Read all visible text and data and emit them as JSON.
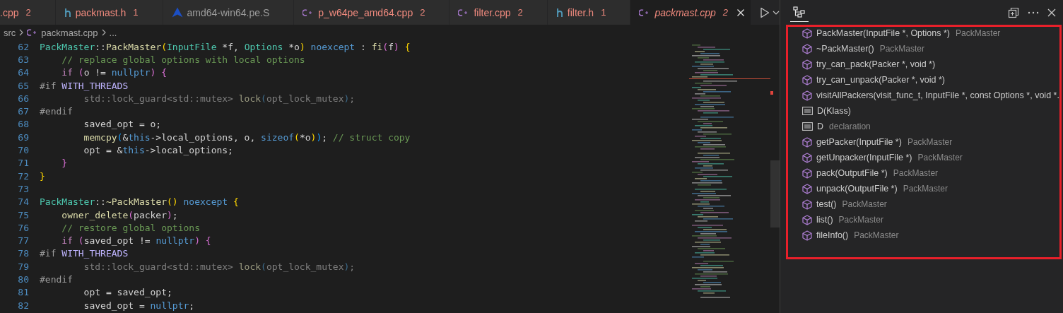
{
  "tabs": [
    {
      "label": ".cpp",
      "problems": "2",
      "selected": false,
      "preview": false
    },
    {
      "kind": "h",
      "label": "packmast.h",
      "problems": "1",
      "selected": false,
      "preview": false
    },
    {
      "kind": "asm",
      "label": "amd64-win64.pe.S",
      "selected": false,
      "preview": false
    },
    {
      "kind": "cpp",
      "label": "p_w64pe_amd64.cpp",
      "problems": "2",
      "selected": false,
      "preview": false
    },
    {
      "kind": "cpp",
      "label": "filter.cpp",
      "problems": "2",
      "selected": false,
      "preview": false
    },
    {
      "kind": "h",
      "label": "filter.h",
      "problems": "1",
      "selected": false,
      "preview": false
    },
    {
      "kind": "cpp",
      "label": "packmast.cpp",
      "problems": "2",
      "selected": true,
      "preview": true
    }
  ],
  "breadcrumb": [
    {
      "kind": "folder",
      "label": "src"
    },
    {
      "kind": "cpp",
      "label": "packmast.cpp"
    },
    {
      "kind": "more",
      "label": "..."
    }
  ],
  "code": [
    {
      "number": "62",
      "tokens": [
        {
          "kind": "cls",
          "text": "PackMaster"
        },
        {
          "kind": "plain",
          "text": "::"
        },
        {
          "kind": "fn",
          "text": "PackMaster"
        },
        {
          "kind": "br1",
          "text": "("
        },
        {
          "kind": "cls",
          "text": "InputFile"
        },
        {
          "kind": "plain",
          "text": " *f, "
        },
        {
          "kind": "cls",
          "text": "Options"
        },
        {
          "kind": "plain",
          "text": " *o"
        },
        {
          "kind": "br1",
          "text": ")"
        },
        {
          "kind": "kw",
          "text": " noexcept"
        },
        {
          "kind": "plain",
          "text": " : "
        },
        {
          "kind": "fn",
          "text": "fi"
        },
        {
          "kind": "br2",
          "text": "("
        },
        {
          "kind": "plain",
          "text": "f"
        },
        {
          "kind": "br2",
          "text": ")"
        },
        {
          "kind": "br1",
          "text": " {"
        }
      ]
    },
    {
      "number": "63",
      "tokens": [
        {
          "kind": "comment",
          "text": "    // replace global options with local options"
        }
      ]
    },
    {
      "number": "64",
      "tokens": [
        {
          "kind": "ctrl",
          "text": "    if"
        },
        {
          "kind": "br2",
          "text": " ("
        },
        {
          "kind": "plain",
          "text": "o != "
        },
        {
          "kind": "kw",
          "text": "nullptr"
        },
        {
          "kind": "br2",
          "text": ") {"
        }
      ]
    },
    {
      "number": "65",
      "tokens": [
        {
          "kind": "pre",
          "text": "#if "
        },
        {
          "kind": "macro",
          "text": "WITH_THREADS"
        }
      ]
    },
    {
      "number": "66",
      "tokens": [
        {
          "kind": "dim",
          "text": "        std::lock_guard<std::mutex> "
        },
        {
          "kind": "dimfn",
          "text": "lock"
        },
        {
          "kind": "dimbr",
          "text": "("
        },
        {
          "kind": "dim",
          "text": "opt_lock_mutex"
        },
        {
          "kind": "dimbr",
          "text": ")"
        },
        {
          "kind": "dim",
          "text": ";"
        }
      ]
    },
    {
      "number": "67",
      "tokens": [
        {
          "kind": "pre",
          "text": "#endif"
        }
      ]
    },
    {
      "number": "68",
      "tokens": [
        {
          "kind": "plain",
          "text": "        saved_opt = o;"
        }
      ]
    },
    {
      "number": "69",
      "tokens": [
        {
          "kind": "fn",
          "text": "        memcpy"
        },
        {
          "kind": "br3",
          "text": "("
        },
        {
          "kind": "plain",
          "text": "&"
        },
        {
          "kind": "kw",
          "text": "this"
        },
        {
          "kind": "plain",
          "text": "->local_options, o, "
        },
        {
          "kind": "kw",
          "text": "sizeof"
        },
        {
          "kind": "br1",
          "text": "("
        },
        {
          "kind": "plain",
          "text": "*o"
        },
        {
          "kind": "br1",
          "text": ")"
        },
        {
          "kind": "br3",
          "text": ")"
        },
        {
          "kind": "plain",
          "text": "; "
        },
        {
          "kind": "comment",
          "text": "// struct copy"
        }
      ]
    },
    {
      "number": "70",
      "tokens": [
        {
          "kind": "plain",
          "text": "        opt = &"
        },
        {
          "kind": "kw",
          "text": "this"
        },
        {
          "kind": "plain",
          "text": "->local_options;"
        }
      ]
    },
    {
      "number": "71",
      "tokens": [
        {
          "kind": "br2",
          "text": "    }"
        }
      ]
    },
    {
      "number": "72",
      "tokens": [
        {
          "kind": "br1",
          "text": "}"
        }
      ]
    },
    {
      "number": "73"
    },
    {
      "number": "74",
      "tokens": [
        {
          "kind": "cls",
          "text": "PackMaster"
        },
        {
          "kind": "plain",
          "text": "::"
        },
        {
          "kind": "fn",
          "text": "~PackMaster"
        },
        {
          "kind": "br1",
          "text": "()"
        },
        {
          "kind": "kw",
          "text": " noexcept"
        },
        {
          "kind": "br1",
          "text": " {"
        }
      ]
    },
    {
      "number": "75",
      "tokens": [
        {
          "kind": "fn",
          "text": "    owner_delete"
        },
        {
          "kind": "br2",
          "text": "("
        },
        {
          "kind": "plain",
          "text": "packer"
        },
        {
          "kind": "br2",
          "text": ")"
        },
        {
          "kind": "plain",
          "text": ";"
        }
      ]
    },
    {
      "number": "76",
      "tokens": [
        {
          "kind": "comment",
          "text": "    // restore global options"
        }
      ]
    },
    {
      "number": "77",
      "tokens": [
        {
          "kind": "ctrl",
          "text": "    if"
        },
        {
          "kind": "br2",
          "text": " ("
        },
        {
          "kind": "plain",
          "text": "saved_opt != "
        },
        {
          "kind": "kw",
          "text": "nullptr"
        },
        {
          "kind": "br2",
          "text": ") {"
        }
      ]
    },
    {
      "number": "78",
      "tokens": [
        {
          "kind": "pre",
          "text": "#if "
        },
        {
          "kind": "macro",
          "text": "WITH_THREADS"
        }
      ]
    },
    {
      "number": "79",
      "tokens": [
        {
          "kind": "dim",
          "text": "        std::lock_guard<std::mutex> "
        },
        {
          "kind": "dimfn",
          "text": "lock"
        },
        {
          "kind": "dimbr",
          "text": "("
        },
        {
          "kind": "dim",
          "text": "opt_lock_mutex"
        },
        {
          "kind": "dimbr",
          "text": ")"
        },
        {
          "kind": "dim",
          "text": ";"
        }
      ]
    },
    {
      "number": "80",
      "tokens": [
        {
          "kind": "pre",
          "text": "#endif"
        }
      ]
    },
    {
      "number": "81",
      "tokens": [
        {
          "kind": "plain",
          "text": "        opt = saved_opt;"
        }
      ]
    },
    {
      "number": "82",
      "tokens": [
        {
          "kind": "plain",
          "text": "        saved_opt = "
        },
        {
          "kind": "kw",
          "text": "nullptr"
        },
        {
          "kind": "plain",
          "text": ";"
        }
      ]
    }
  ],
  "outline": [
    {
      "kind": "method",
      "name": "PackMaster(InputFile *, Options *)",
      "detail": "PackMaster"
    },
    {
      "kind": "method",
      "name": "~PackMaster()",
      "detail": "PackMaster"
    },
    {
      "kind": "method",
      "name": "try_can_pack(Packer *, void *)"
    },
    {
      "kind": "method",
      "name": "try_can_unpack(Packer *, void *)"
    },
    {
      "kind": "method",
      "name": "visitAllPackers(visit_func_t, InputFile *, const Options *, void *."
    },
    {
      "kind": "field",
      "name": "D(Klass)"
    },
    {
      "kind": "field",
      "name": "D",
      "detail": "declaration"
    },
    {
      "kind": "method",
      "name": "getPacker(InputFile *)",
      "detail": "PackMaster"
    },
    {
      "kind": "method",
      "name": "getUnpacker(InputFile *)",
      "detail": "PackMaster"
    },
    {
      "kind": "method",
      "name": "pack(OutputFile *)",
      "detail": "PackMaster"
    },
    {
      "kind": "method",
      "name": "unpack(OutputFile *)",
      "detail": "PackMaster"
    },
    {
      "kind": "method",
      "name": "test()",
      "detail": "PackMaster"
    },
    {
      "kind": "method",
      "name": "list()",
      "detail": "PackMaster"
    },
    {
      "kind": "method",
      "name": "fileInfo()",
      "detail": "PackMaster"
    }
  ]
}
